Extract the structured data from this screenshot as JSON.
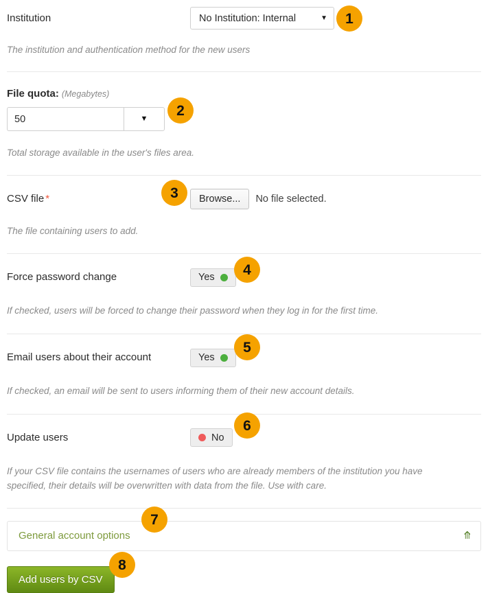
{
  "form": {
    "fields": [
      {
        "key": "institution",
        "label": "Institution",
        "control": "select",
        "value": "No Institution: Internal",
        "help": "The institution and authentication method for the new users",
        "badge": "1"
      },
      {
        "key": "file_quota",
        "label": "File quota:",
        "label_suffix": "(Megabytes)",
        "control": "number-combo",
        "value": "50",
        "help": "Total storage available in the user's files area.",
        "badge": "2"
      },
      {
        "key": "csv_file",
        "label": "CSV file",
        "required_marker": "*",
        "control": "file",
        "button_label": "Browse...",
        "status": "No file selected.",
        "help": "The file containing users to add.",
        "badge": "3"
      },
      {
        "key": "force_password_change",
        "label": "Force password change",
        "control": "switch",
        "value": "Yes",
        "state": "on",
        "help": "If checked, users will be forced to change their password when they log in for the first time.",
        "badge": "4"
      },
      {
        "key": "email_users",
        "label": "Email users about their account",
        "control": "switch",
        "value": "Yes",
        "state": "on",
        "help": "If checked, an email will be sent to users informing them of their new account details.",
        "badge": "5"
      },
      {
        "key": "update_users",
        "label": "Update users",
        "control": "switch",
        "value": "No",
        "state": "off",
        "help": "If your CSV file contains the usernames of users who are already members of the institution you have specified, their details will be overwritten with data from the file. Use with care.",
        "badge": "6"
      }
    ],
    "panel": {
      "title": "General account options",
      "chevron": "chevron-down",
      "badge": "7"
    },
    "submit": {
      "label": "Add users by CSV",
      "badge": "8"
    }
  },
  "colors": {
    "badge_background": "#f5a200",
    "badge_text": "#121212",
    "switch_on_dot": "#4caf3e",
    "switch_off_dot": "#ef5a5a",
    "required_star": "#f0573d",
    "panel_title": "#7d9a3c",
    "submit_button": "#6f9c17",
    "help_text": "#8a8a8a",
    "divider": "#e8e8e8"
  }
}
